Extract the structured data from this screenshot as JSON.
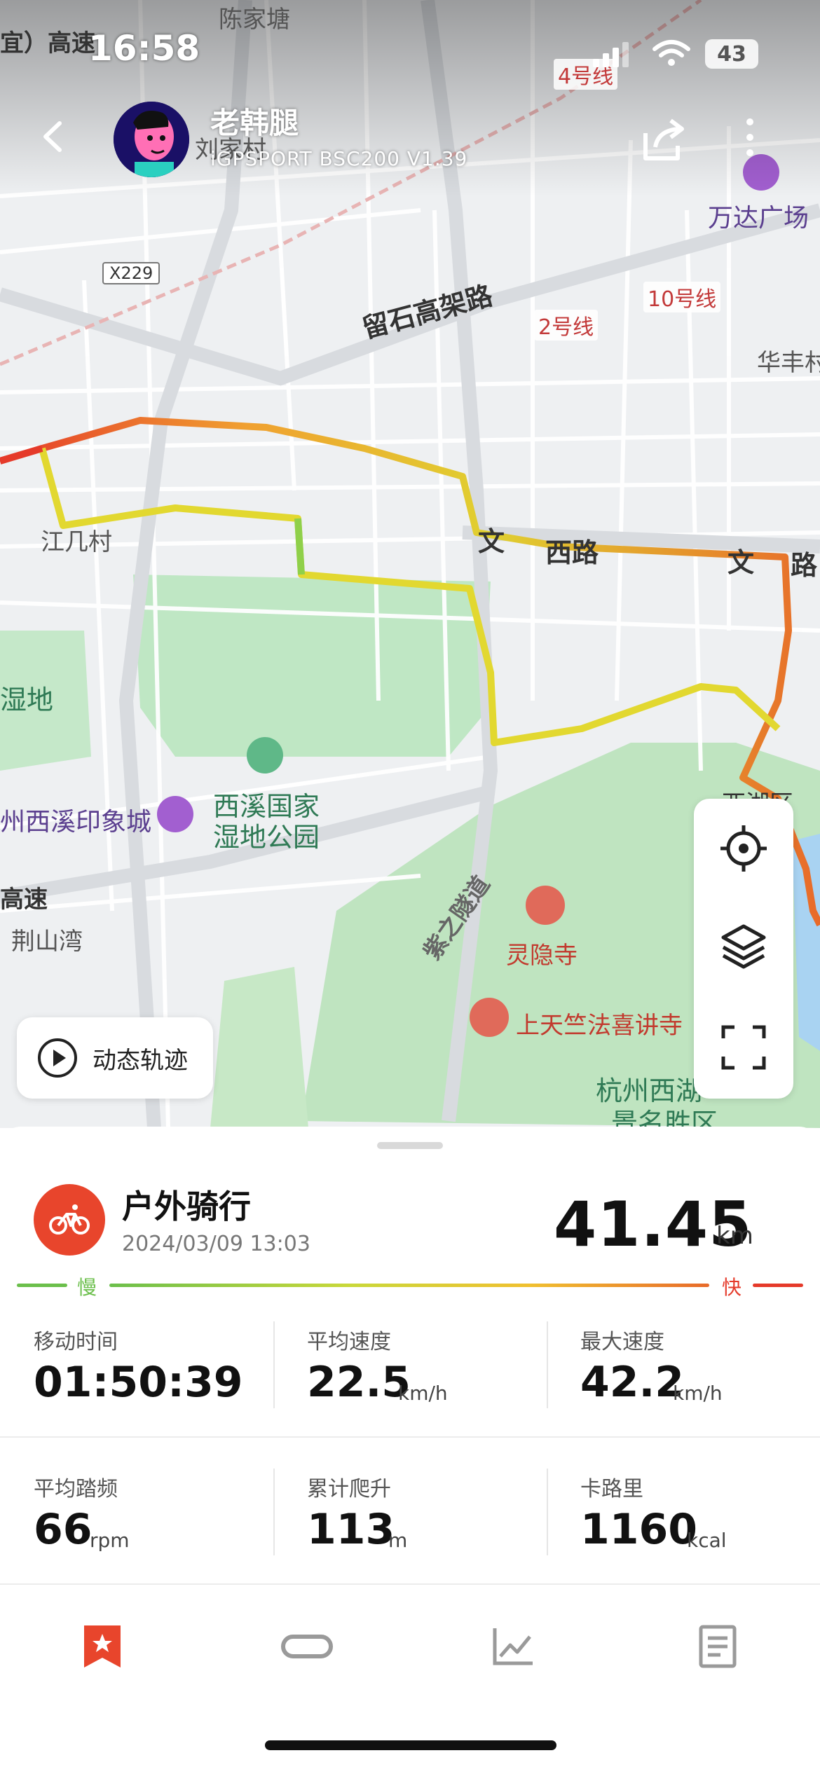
{
  "status_bar": {
    "time": "16:58",
    "battery": "43"
  },
  "header": {
    "username": "老韩腿",
    "device": "iGPSPORT BSC200 V1.39"
  },
  "map": {
    "labels": {
      "chenjiatang": "陈家塘",
      "yi_gaosu": "宜）高速",
      "liujiacun": "刘家村",
      "x229": "X229",
      "metro4": "4号线",
      "wanda": "万达广场",
      "metro10": "10号线",
      "metro2": "2号线",
      "liushi": "留石高架路",
      "huafeng": "华丰村",
      "jiangcun": "江几村",
      "wenxi_a": "文",
      "wenxi_b": "西路",
      "wenxi_c": "文",
      "wenxi_d": "路",
      "shidi": "湿地",
      "xixi_park_1": "西溪国家",
      "xixi_park_2": "湿地公园",
      "yinxiang": "州西溪印象城",
      "gaosu": "高速",
      "jingshan": "荆山湾",
      "zizhi": "紫之隧道",
      "lingyin": "灵隐寺",
      "shangtianzhu": "上天竺法喜讲寺",
      "xihu_1": "杭州西湖",
      "xihu_2": "景名胜区",
      "xihu_qu": "西湖区"
    }
  },
  "replay": {
    "label": "动态轨迹"
  },
  "summary": {
    "activity": "户外骑行",
    "datetime": "2024/03/09 13:03",
    "distance": "41.45",
    "distance_unit": "km",
    "legend_slow": "慢",
    "legend_fast": "快"
  },
  "stats": [
    {
      "label": "移动时间",
      "value": "01:50:39",
      "unit": ""
    },
    {
      "label": "平均速度",
      "value": "22.5",
      "unit": "km/h"
    },
    {
      "label": "最大速度",
      "value": "42.2",
      "unit": "km/h"
    },
    {
      "label": "平均踏频",
      "value": "66",
      "unit": "rpm"
    },
    {
      "label": "累计爬升",
      "value": "113",
      "unit": "m"
    },
    {
      "label": "卡路里",
      "value": "1160",
      "unit": "kcal"
    }
  ],
  "tabs": [
    {
      "icon": "star-bookmark-icon",
      "active": true
    },
    {
      "icon": "link-icon",
      "active": false
    },
    {
      "icon": "line-chart-icon",
      "active": false
    },
    {
      "icon": "document-icon",
      "active": false
    }
  ],
  "colors": {
    "accent": "#e8452c",
    "slow": "#6bbf4b",
    "mid": "#f0d43a",
    "fast": "#e53a2a",
    "tab_inactive": "#9a9a9a"
  }
}
